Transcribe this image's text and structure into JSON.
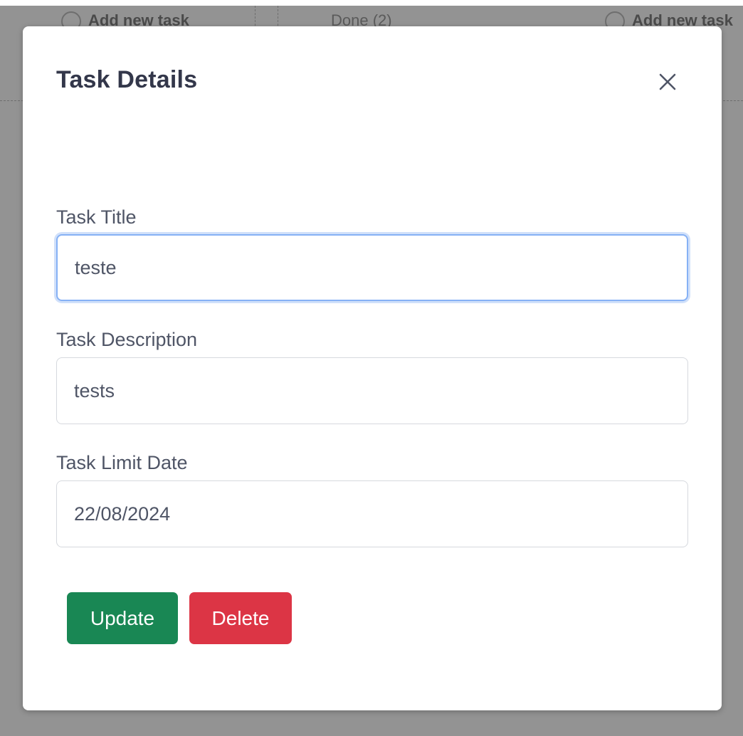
{
  "board": {
    "columns": [
      {
        "header": "Add new task"
      },
      {
        "header": "Done (2)"
      },
      {
        "header": "Add new task"
      }
    ]
  },
  "modal": {
    "title": "Task Details",
    "close_icon": "close-icon",
    "fields": [
      {
        "label": "Task Title",
        "value": "teste",
        "focused": true
      },
      {
        "label": "Task Description",
        "value": "tests",
        "focused": false
      },
      {
        "label": "Task Limit Date",
        "value": "22/08/2024",
        "focused": false
      }
    ],
    "buttons": {
      "update_label": "Update",
      "delete_label": "Delete"
    }
  },
  "colors": {
    "update": "#198754",
    "delete": "#dc3545",
    "focus_ring": "#86b1f5",
    "title_text": "#33374a"
  }
}
